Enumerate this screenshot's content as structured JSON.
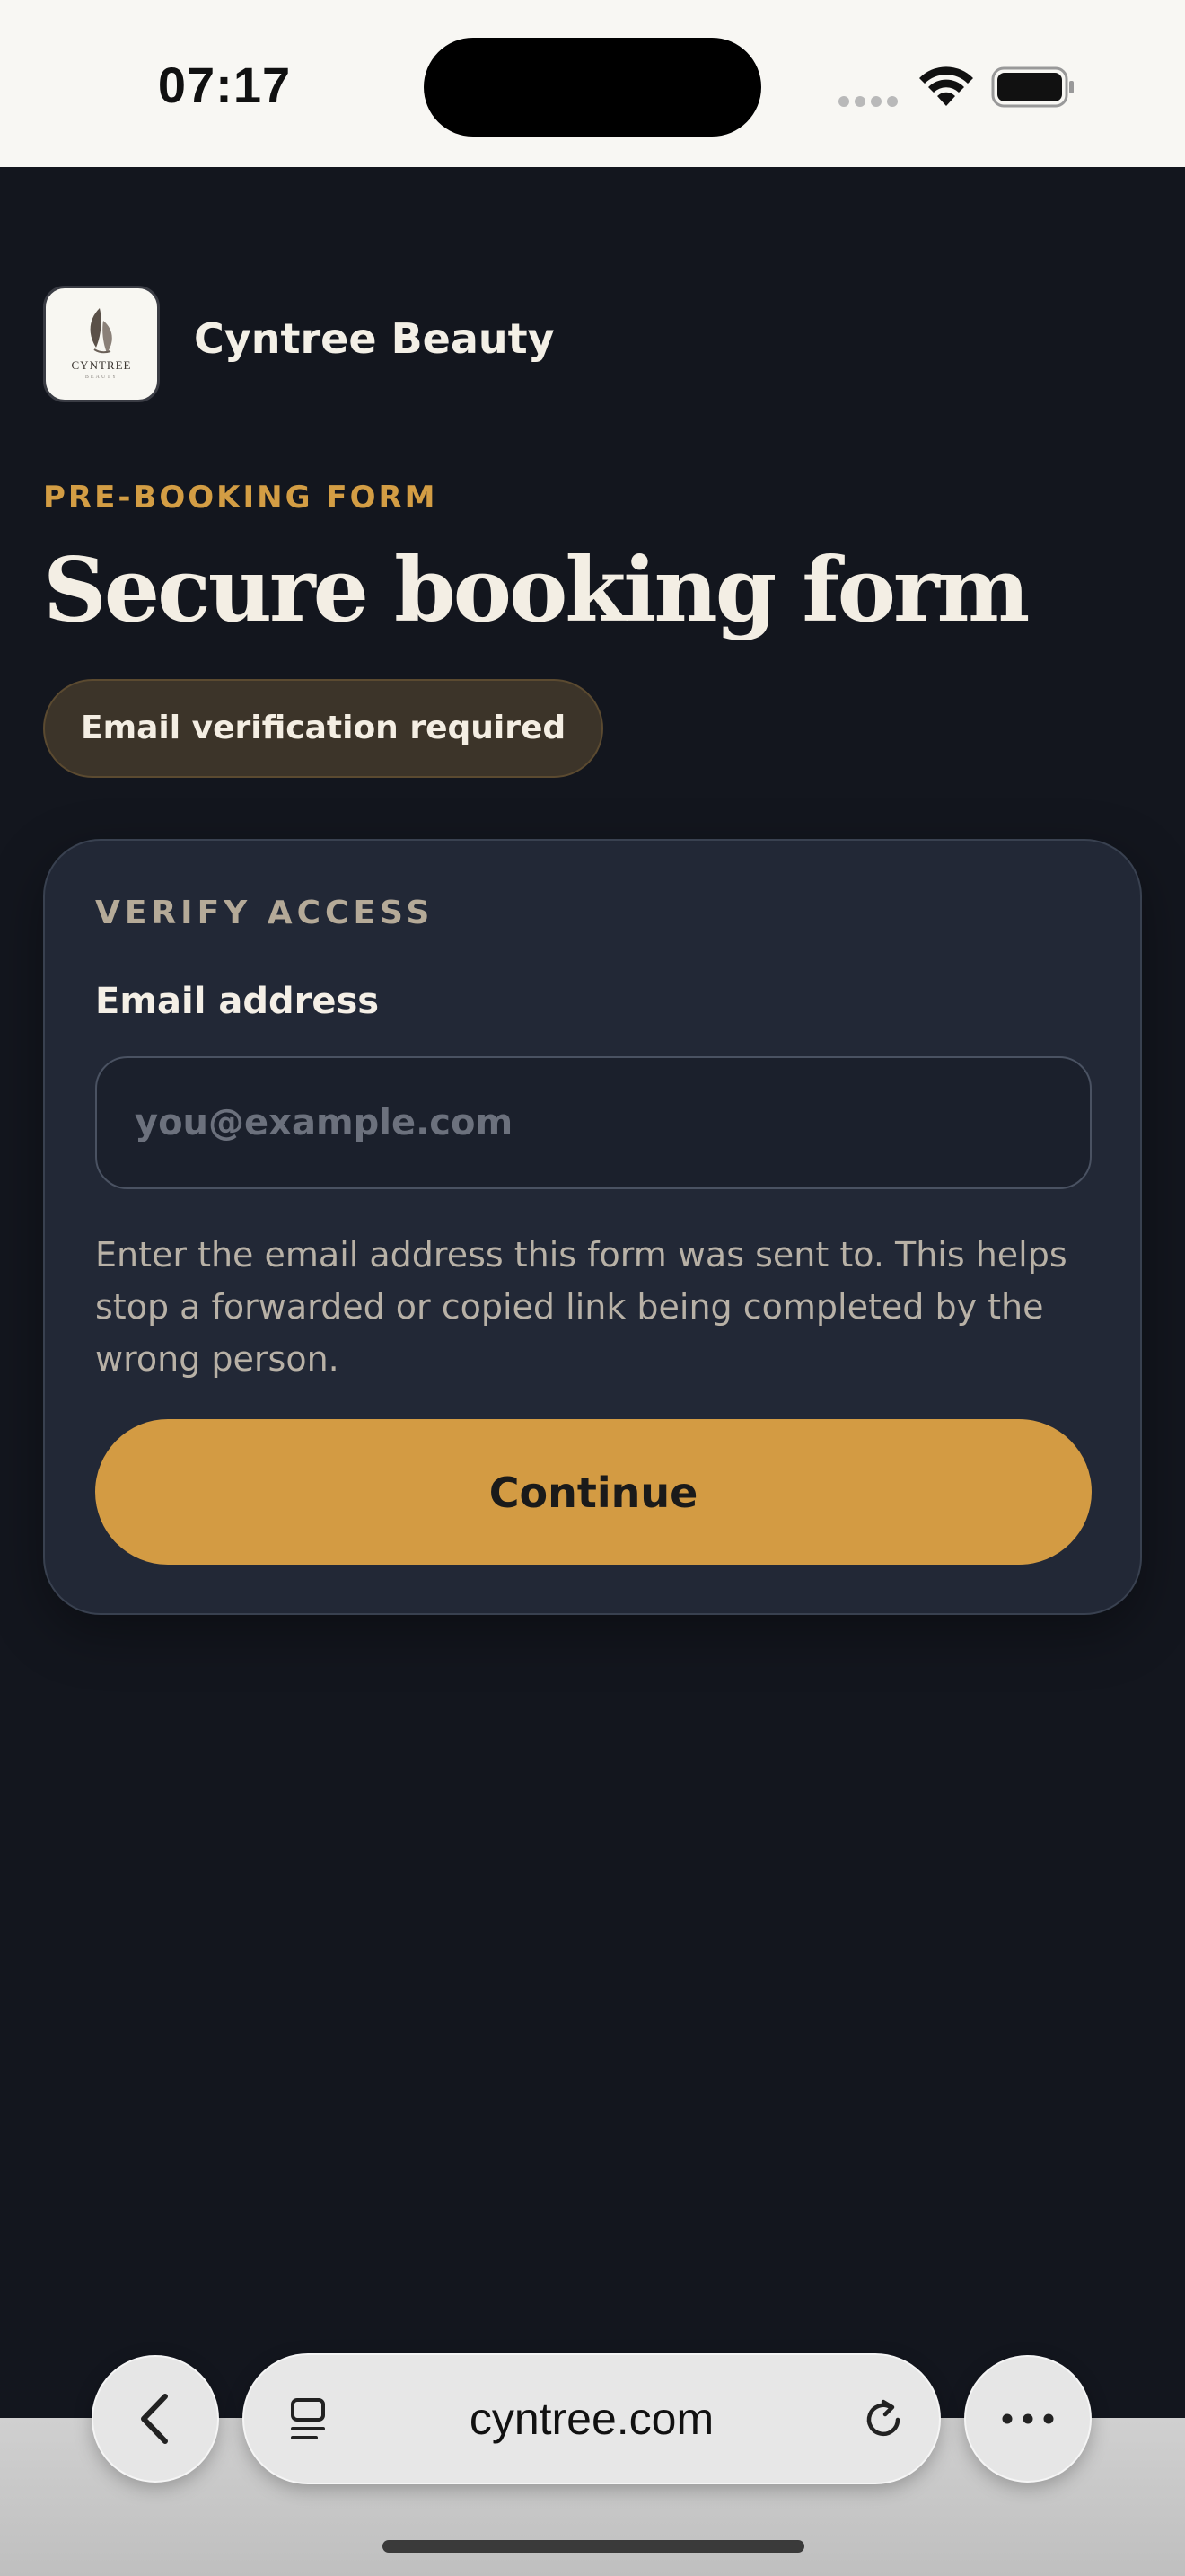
{
  "status_bar": {
    "time": "07:17",
    "icons": [
      "signal-icon",
      "wifi-icon",
      "battery-icon"
    ]
  },
  "header": {
    "logo_text": "CYNTREE",
    "logo_subtext": "BEAUTY",
    "brand_name": "Cyntree Beauty"
  },
  "page": {
    "eyebrow": "PRE-BOOKING FORM",
    "title": "Secure booking form",
    "badge": "Email verification required"
  },
  "card": {
    "section_label": "VERIFY ACCESS",
    "email_label": "Email address",
    "email_value": "",
    "email_placeholder": "you@example.com",
    "help_text": "Enter the email address this form was sent to. This helps stop a forwarded or copied link being completed by the wrong person.",
    "continue_label": "Continue"
  },
  "browser": {
    "url": "cyntree.com",
    "icons": [
      "back-icon",
      "tabs-icon",
      "reload-icon",
      "more-icon"
    ]
  },
  "colors": {
    "background": "#13161e",
    "accent": "#d39b43",
    "card": "#222836"
  }
}
